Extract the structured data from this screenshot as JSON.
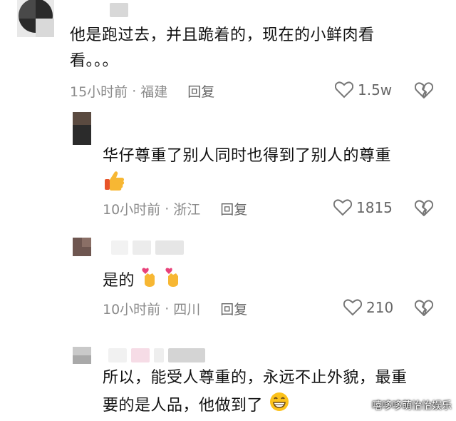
{
  "comments": [
    {
      "text_line1": "他是跑过去，并且跪着的，现在的小鲜肉看",
      "text_line2": "看。。。",
      "time": "15小时前",
      "location": "福建",
      "reply": "回复",
      "likes": "1.5w"
    },
    {
      "text_line1": "华仔尊重了别人同时也得到了别人的尊重",
      "emoji": "thumbs-up-emoji",
      "time": "10小时前",
      "location": "浙江",
      "reply": "回复",
      "likes": "1815"
    },
    {
      "text_line1": "是的",
      "emoji": "finger-heart-emoji",
      "time": "10小时前",
      "location": "四川",
      "reply": "回复",
      "likes": "210"
    },
    {
      "text_line1": "所以，能受人尊重的，永远不止外貌，最重",
      "text_line2": "要的是人品，他做到了",
      "emoji": "grinning-emoji"
    }
  ],
  "separator": "·",
  "watermark": "嘻哆哆萌怡怡娱乐"
}
